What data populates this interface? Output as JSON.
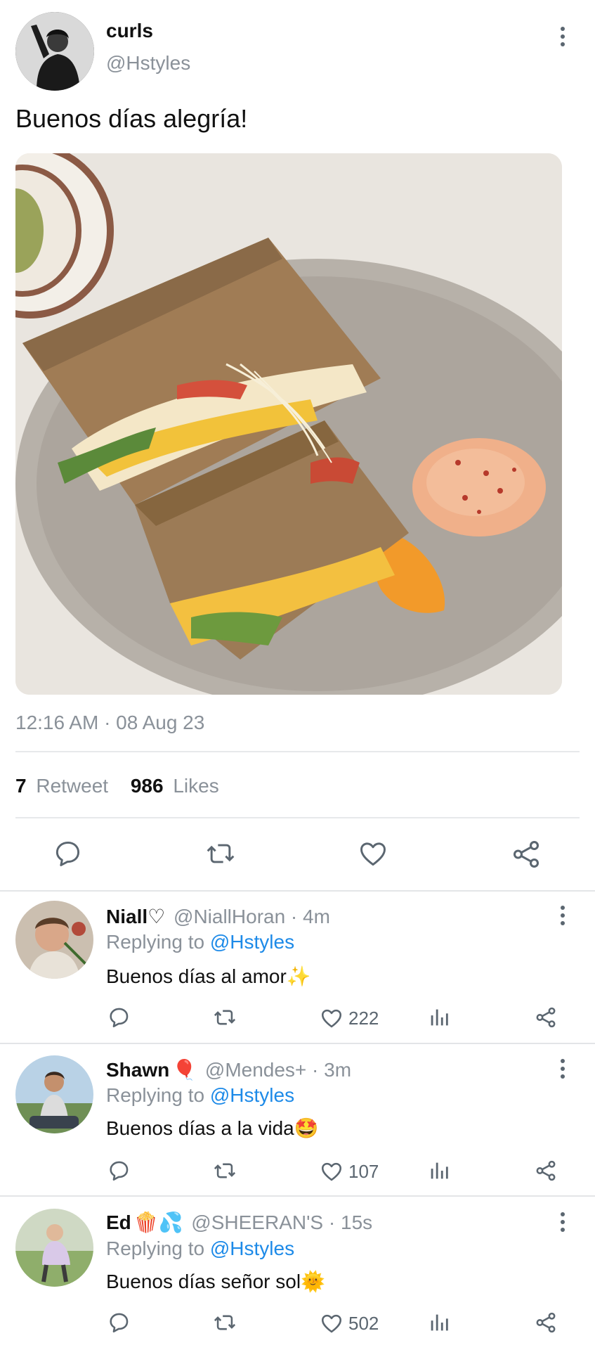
{
  "tweet": {
    "display_name": "curls",
    "handle": "@Hstyles",
    "text": "Buenos días alegría!",
    "timestamp": "12:16 AM · 08 Aug 23",
    "retweets_count": "7",
    "retweets_label": "Retweet",
    "likes_count": "986",
    "likes_label": "Likes",
    "image_icon": "sandwich-photo"
  },
  "replies": [
    {
      "display_name": "Niall♡",
      "handle_time": "@NiallHoran · 4m",
      "replying_prefix": "Replying to",
      "replying_handle": "@Hstyles",
      "text": "Buenos días al amor",
      "emoji": "✨",
      "likes": "222"
    },
    {
      "display_name": "Shawn",
      "name_emoji": "🎈",
      "handle_time": "@Mendes+ · 3m",
      "replying_prefix": "Replying to",
      "replying_handle": "@Hstyles",
      "text": "Buenos días a la vida",
      "emoji": "🤩",
      "likes": "107"
    },
    {
      "display_name": "Ed",
      "name_emoji": "🍿💦",
      "handle_time": "@SHEERAN'S · 15s",
      "replying_prefix": "Replying to",
      "replying_handle": "@Hstyles",
      "text": "Buenos días señor sol",
      "emoji": "🌞",
      "likes": "502"
    }
  ],
  "colors": {
    "link": "#1d8ae8",
    "muted": "#8a9199",
    "icon": "#5b6670"
  }
}
